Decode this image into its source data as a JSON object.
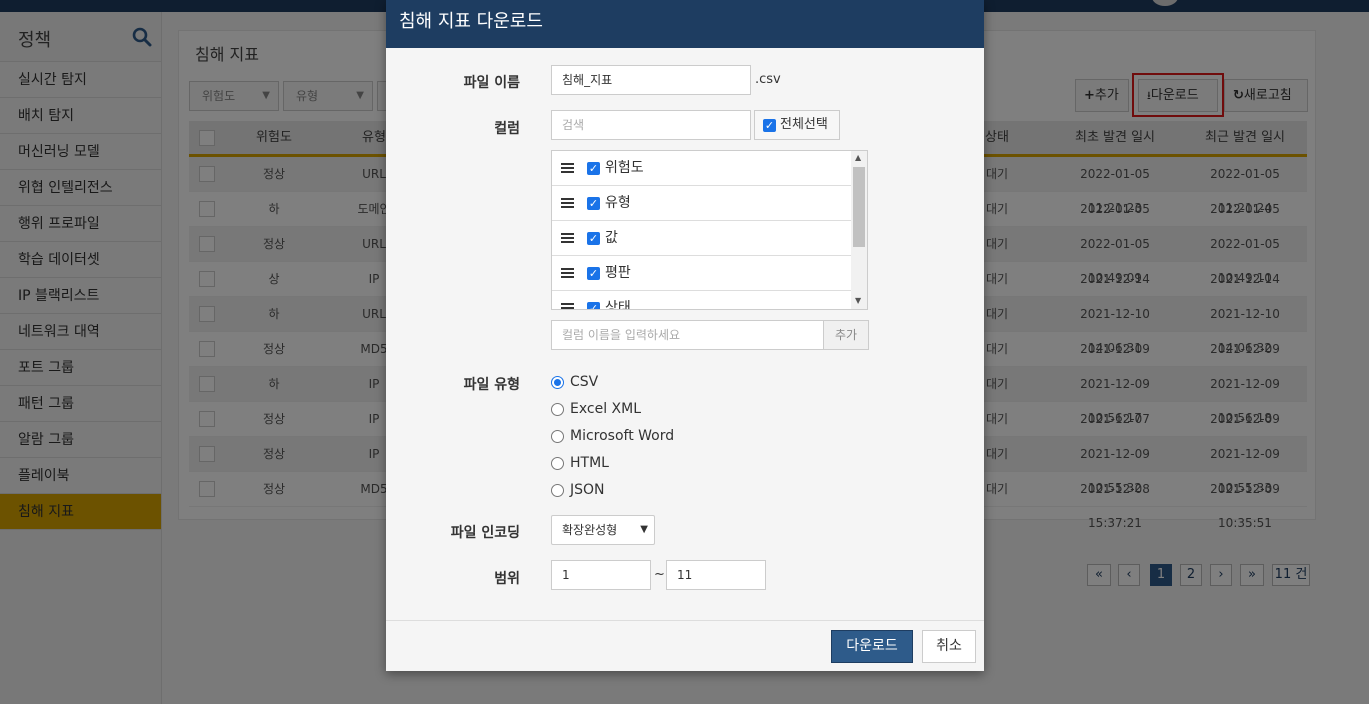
{
  "sidebar": {
    "title": "정책",
    "items": [
      {
        "label": "실시간 탐지"
      },
      {
        "label": "배치 탐지"
      },
      {
        "label": "머신러닝 모델"
      },
      {
        "label": "위협 인텔리전스"
      },
      {
        "label": "행위 프로파일"
      },
      {
        "label": "학습 데이터셋"
      },
      {
        "label": "IP 블랙리스트"
      },
      {
        "label": "네트워크 대역"
      },
      {
        "label": "포트 그룹"
      },
      {
        "label": "패턴 그룹"
      },
      {
        "label": "알람 그룹"
      },
      {
        "label": "플레이북"
      },
      {
        "label": "침해 지표"
      }
    ]
  },
  "page": {
    "title": "침해 지표",
    "filters": [
      "위험도",
      "유형"
    ],
    "toolbar": {
      "add": "추가",
      "download": "다운로드",
      "refresh": "새로고침"
    },
    "columns": [
      "위험도",
      "유형",
      "상태",
      "최초 발견 일시",
      "최근 발견 일시"
    ],
    "rows": [
      {
        "risk": "정상",
        "type": "URL",
        "status": "대기",
        "first": "2022-01-05 11:21:23",
        "last": "2022-01-05 11:21:24"
      },
      {
        "risk": "하",
        "type": "도메인",
        "status": "대기",
        "first": "2022-01-05 10:51:47",
        "last": "2022-01-05 10:51:47"
      },
      {
        "risk": "정상",
        "type": "URL",
        "status": "대기",
        "first": "2022-01-05 10:49:09",
        "last": "2022-01-05 10:49:10"
      },
      {
        "risk": "상",
        "type": "IP",
        "status": "대기",
        "first": "2021-12-14 17:02:19",
        "last": "2021-12-14 17:22:55"
      },
      {
        "risk": "하",
        "type": "URL",
        "status": "대기",
        "first": "2021-12-10 14:06:31",
        "last": "2021-12-10 14:06:32"
      },
      {
        "risk": "정상",
        "type": "MD5",
        "status": "대기",
        "first": "2021-12-09 11:16:04",
        "last": "2021-12-09 17:54:00"
      },
      {
        "risk": "하",
        "type": "IP",
        "status": "대기",
        "first": "2021-12-09 10:56:17",
        "last": "2021-12-09 10:56:18"
      },
      {
        "risk": "정상",
        "type": "IP",
        "status": "대기",
        "first": "2021-12-07 12:10:51",
        "last": "2021-12-09 10:55:48"
      },
      {
        "risk": "정상",
        "type": "IP",
        "status": "대기",
        "first": "2021-12-09 10:55:32",
        "last": "2021-12-09 10:55:33"
      },
      {
        "risk": "정상",
        "type": "MD5",
        "status": "대기",
        "first": "2021-12-08 15:37:21",
        "last": "2021-12-09 10:35:51"
      }
    ],
    "pagination": {
      "first": "«",
      "prev": "‹",
      "pages": [
        "1",
        "2"
      ],
      "next": "›",
      "last": "»",
      "total": "11 건"
    }
  },
  "modal": {
    "title": "침해 지표 다운로드",
    "file_name_label": "파일 이름",
    "file_name_value": "침해_지표",
    "file_ext": ".csv",
    "column_label": "컬럼",
    "search_placeholder": "검색",
    "select_all": "전체선택",
    "columns": [
      {
        "label": "위험도",
        "checked": true
      },
      {
        "label": "유형",
        "checked": true
      },
      {
        "label": "값",
        "checked": true
      },
      {
        "label": "평판",
        "checked": true
      },
      {
        "label": "상태",
        "checked": true
      }
    ],
    "column_input_placeholder": "컬럼 이름을 입력하세요",
    "column_add": "추가",
    "file_type_label": "파일 유형",
    "file_types": [
      {
        "label": "CSV",
        "selected": true
      },
      {
        "label": "Excel XML",
        "selected": false
      },
      {
        "label": "Microsoft Word",
        "selected": false
      },
      {
        "label": "HTML",
        "selected": false
      },
      {
        "label": "JSON",
        "selected": false
      }
    ],
    "encoding_label": "파일 인코딩",
    "encoding_value": "확장완성형",
    "range_label": "범위",
    "range_from": "1",
    "range_sep": "~",
    "range_to": "11",
    "submit": "다운로드",
    "cancel": "취소"
  },
  "colors": {
    "header": "#1e3d61",
    "accent": "#d9a400",
    "primary": "#2e5b8a",
    "highlight": "#e01818",
    "checkbox": "#1a73e8"
  }
}
